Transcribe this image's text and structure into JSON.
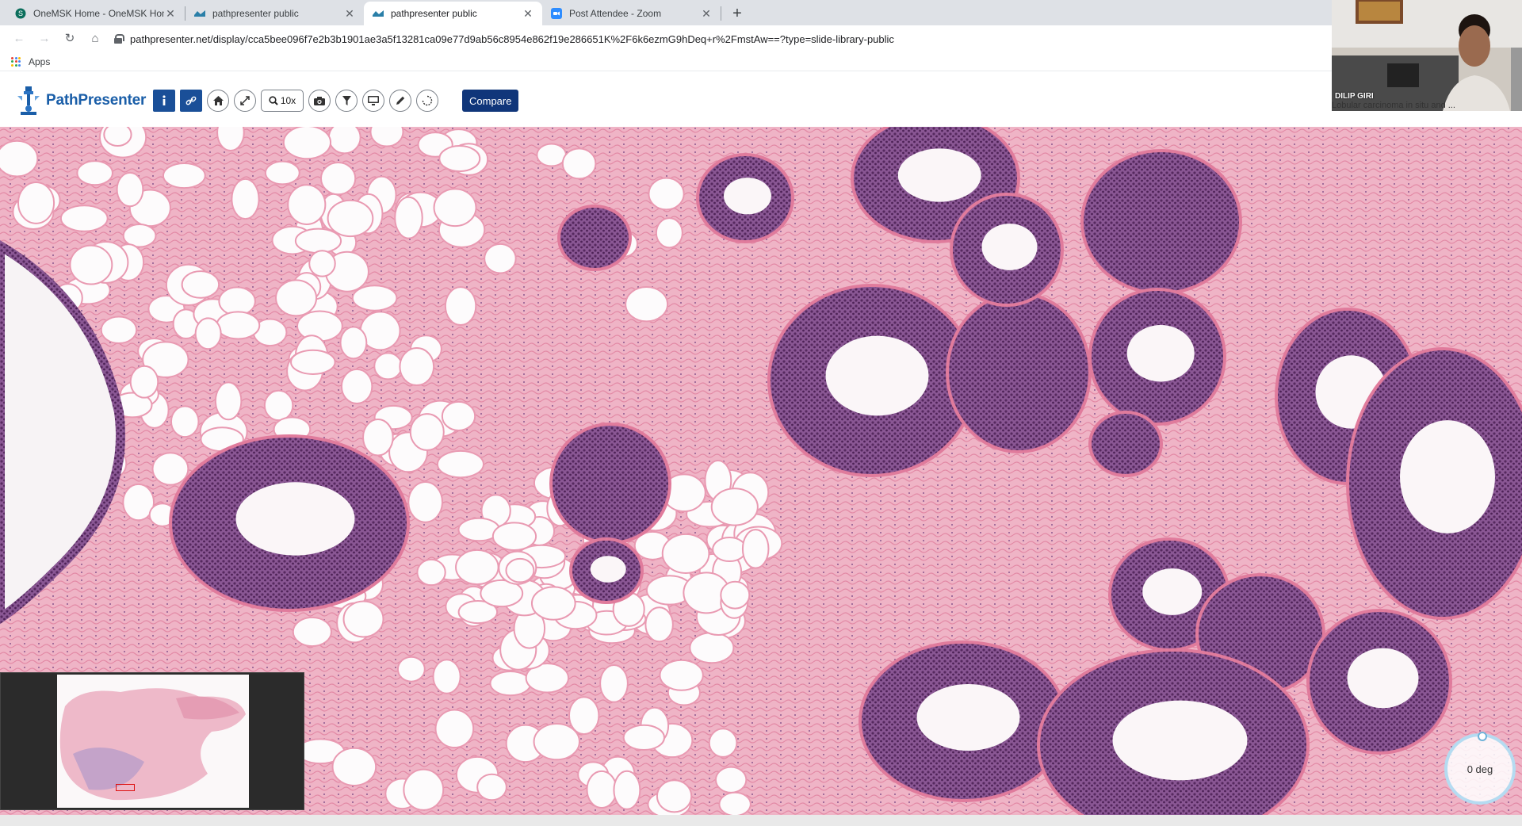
{
  "browser": {
    "tabs": [
      {
        "title": "OneMSK Home - OneMSK Home",
        "active": false
      },
      {
        "title": "pathpresenter public",
        "active": false
      },
      {
        "title": "pathpresenter public",
        "active": true
      },
      {
        "title": "Post Attendee - Zoom",
        "active": false
      }
    ],
    "new_tab_label": "+",
    "url": "pathpresenter.net/display/cca5bee096f7e2b3b1901ae3a5f13281ca09e77d9ab56c8954e862f19e286651K%2F6k6ezmG9hDeq+r%2FmstAw==?type=slide-library-public",
    "bookmarks_apps": "Apps"
  },
  "app": {
    "name": "PathPresenter",
    "zoom_level": "10x",
    "compare_label": "Compare",
    "tools": [
      "info-icon",
      "link-icon",
      "home-icon",
      "fullscreen-icon",
      "zoom-icon",
      "camera-icon",
      "filter-icon",
      "monitor-icon",
      "pencil-icon",
      "rotate-icon"
    ]
  },
  "video": {
    "speaker": "DILIP GIRI",
    "caption": "Lobular carcinoma in situ and ..."
  },
  "viewer": {
    "rotation_label": "0 deg"
  },
  "colors": {
    "brand": "#1a5ea8",
    "tool_blue": "#1a4f98",
    "compare_bg": "#10367a",
    "stroma": "#f0bfcf",
    "nuclei": "#6b3d7e"
  }
}
